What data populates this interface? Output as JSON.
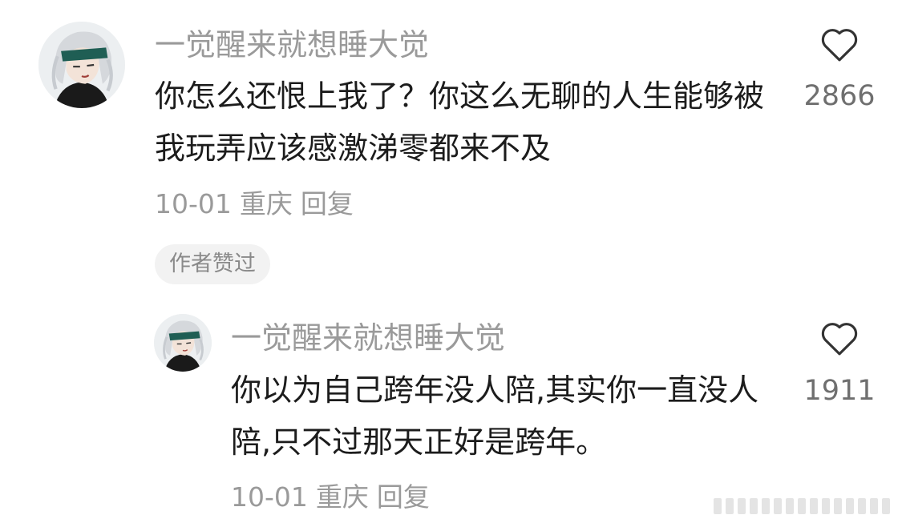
{
  "comments": [
    {
      "username": "一觉醒来就想睡大觉",
      "text": "你怎么还恨上我了？你这么无聊的人生能够被我玩弄应该感激涕零都来不及",
      "date": "10-01",
      "location": "重庆",
      "reply_label": "回复",
      "like_count": "2866",
      "author_liked_label": "作者赞过"
    },
    {
      "username": "一觉醒来就想睡大觉",
      "text": "你以为自己跨年没人陪,其实你一直没人陪,只不过那天正好是跨年。",
      "date": "10-01",
      "location": "重庆",
      "reply_label": "回复",
      "like_count": "1911"
    }
  ],
  "icons": {
    "like": "heart-outline-icon",
    "avatar": "avatar-illustration"
  },
  "colors": {
    "text_primary": "#1c1c1c",
    "text_secondary": "#9a9a9a",
    "badge_bg": "#f2f2f2"
  }
}
